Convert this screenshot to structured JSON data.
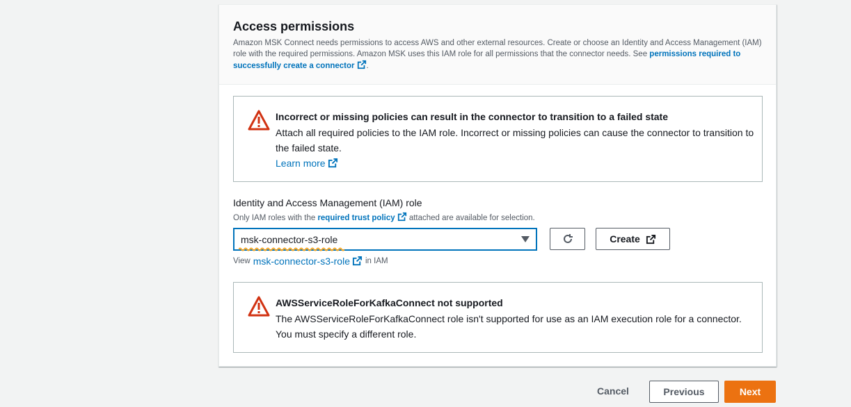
{
  "section": {
    "title": "Access permissions",
    "description_prefix": "Amazon MSK Connect needs permissions to access AWS and other external resources. Create or choose an Identity and Access Management (IAM) role with the required permissions. Amazon MSK uses this IAM role for all permissions that the connector needs. See",
    "description_link": "permissions required to successfully create a connector",
    "description_suffix": "."
  },
  "alert_policies": {
    "title": "Incorrect or missing policies can result in the connector to transition to a failed state",
    "body": "Attach all required policies to the IAM role. Incorrect or missing policies can cause the connector to transition to the failed state.",
    "link": "Learn more"
  },
  "iam_role": {
    "label": "Identity and Access Management (IAM) role",
    "hint_prefix": "Only IAM roles with the",
    "hint_link": "required trust policy",
    "hint_suffix": "attached are available for selection.",
    "selected": "msk-connector-s3-role",
    "create_label": "Create",
    "view_prefix": "View",
    "view_link": "msk-connector-s3-role",
    "view_suffix": "in IAM"
  },
  "alert_role": {
    "title": "AWSServiceRoleForKafkaConnect not supported",
    "body": "The AWSServiceRoleForKafkaConnect role isn't supported for use as an IAM execution role for a connector. You must specify a different role."
  },
  "footer": {
    "cancel": "Cancel",
    "previous": "Previous",
    "next": "Next"
  },
  "colors": {
    "link": "#0073bb",
    "warning": "#d13212",
    "primary": "#ec7211"
  },
  "icons": [
    "external-link-icon",
    "warning-icon",
    "refresh-icon",
    "caret-down-icon"
  ]
}
